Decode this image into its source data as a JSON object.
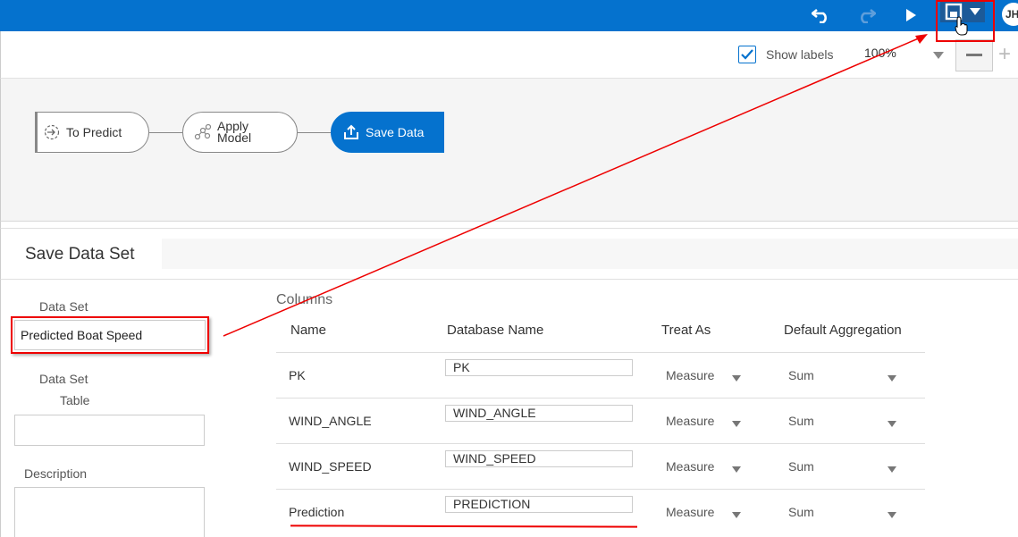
{
  "topbar": {
    "user_initials": "JH",
    "save_tooltip": "Save"
  },
  "zoombar": {
    "show_labels_label": "Show labels",
    "show_labels_checked": true,
    "zoom_value": "100%"
  },
  "flow": {
    "nodes": [
      {
        "label": "To Predict",
        "icon": "data-source-icon"
      },
      {
        "label_line1": "Apply",
        "label_line2": "Model",
        "icon": "apply-model-icon"
      },
      {
        "label": "Save Data",
        "icon": "upload-icon"
      }
    ]
  },
  "panel": {
    "title": "Save Data Set",
    "data_set_label": "Data Set",
    "data_set_value": "Predicted Boat Speed",
    "data_set_table_label_1": "Data Set",
    "data_set_table_label_2": "Table",
    "data_set_table_value": "",
    "description_label": "Description",
    "description_value": ""
  },
  "columns": {
    "title": "Columns",
    "headers": {
      "name": "Name",
      "database_name": "Database Name",
      "treat_as": "Treat As",
      "default_aggregation": "Default Aggregation"
    },
    "rows": [
      {
        "name": "PK",
        "db_name": "PK",
        "treat_as": "Measure",
        "aggregation": "Sum"
      },
      {
        "name": "WIND_ANGLE",
        "db_name": "WIND_ANGLE",
        "treat_as": "Measure",
        "aggregation": "Sum"
      },
      {
        "name": "WIND_SPEED",
        "db_name": "WIND_SPEED",
        "treat_as": "Measure",
        "aggregation": "Sum"
      },
      {
        "name": "Prediction",
        "db_name": "PREDICTION",
        "treat_as": "Measure",
        "aggregation": "Sum"
      }
    ]
  },
  "colors": {
    "brand_blue": "#0572ce",
    "highlight_red": "#e00000"
  }
}
